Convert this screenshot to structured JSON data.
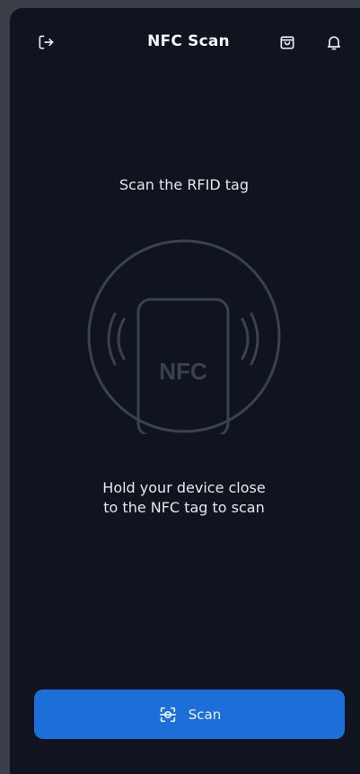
{
  "header": {
    "title": "NFC Scan",
    "icons": [
      "logout-icon",
      "shopping-bag-icon",
      "bell-icon"
    ]
  },
  "main": {
    "instruction": "Scan the RFID tag",
    "illustration": {
      "label": "NFC",
      "icon": "nfc-phone-icon"
    },
    "hint_line1": "Hold your device close",
    "hint_line2": "to the NFC tag to scan"
  },
  "actions": {
    "scan_label": "Scan",
    "scan_icon": "scan-frame-icon"
  },
  "colors": {
    "background": "#0f141f",
    "primary": "#1c6fd9",
    "text": "#e6e8ec",
    "illustration_stroke": "#3a4250"
  }
}
